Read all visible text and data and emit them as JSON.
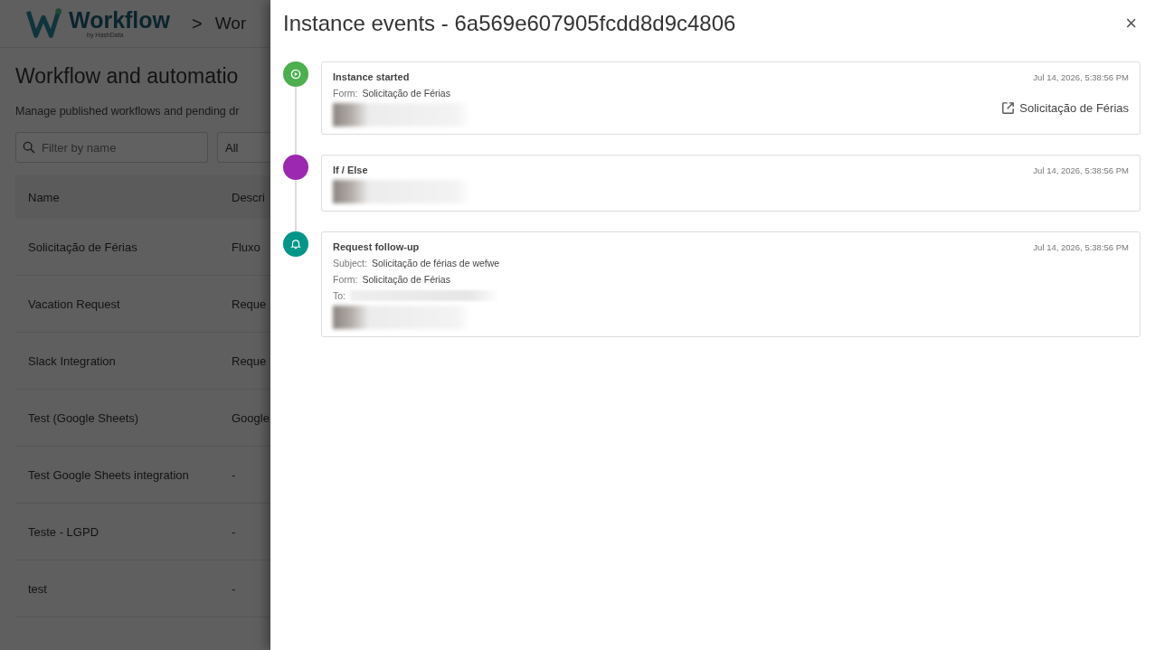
{
  "app": {
    "logo": {
      "name": "Workflow",
      "tagline": "by HashData"
    },
    "breadcrumb": [
      ">",
      "Wor"
    ],
    "title": "Workflow and automatio",
    "subtitle": "Manage published workflows and pending dr",
    "search": {
      "placeholder": "Filter by name"
    },
    "filter": {
      "value": "All"
    },
    "table": {
      "columns": [
        "Name",
        "Descri"
      ],
      "rows": [
        [
          "Solicitação de Férias",
          "Fluxo"
        ],
        [
          "Vacation Request",
          "Reque"
        ],
        [
          "Slack Integration",
          "Reque"
        ],
        [
          "Test (Google Sheets)",
          "Google"
        ],
        [
          "Test Google Sheets integration",
          "-"
        ],
        [
          "Teste - LGPD",
          "-"
        ],
        [
          "test",
          "-"
        ]
      ]
    }
  },
  "dialog": {
    "title": "Instance events - 6a569e607905fcdd8d9c4806",
    "close": "×",
    "events": [
      {
        "kind": "started",
        "color": "#4caf50",
        "title": "Instance started",
        "time": "Jul 14, 2026, 5:38:56 PM",
        "fields": [
          {
            "label": "Form:",
            "value": "Solicitação de Férias"
          }
        ],
        "link": "Solicitação de Férias"
      },
      {
        "kind": "condition",
        "color": "#9c27b0",
        "title": "If / Else",
        "time": "Jul 14, 2026, 5:38:56 PM"
      },
      {
        "kind": "notification",
        "color": "#009688",
        "title": "Request follow-up",
        "time": "Jul 14, 2026, 5:38:56 PM",
        "fields": [
          {
            "label": "Subject:",
            "value": "Solicitação de férias de wefwe"
          },
          {
            "label": "Form:",
            "value": "Solicitação de Férias"
          },
          {
            "label": "To:",
            "kind": "redacted"
          }
        ]
      }
    ]
  }
}
